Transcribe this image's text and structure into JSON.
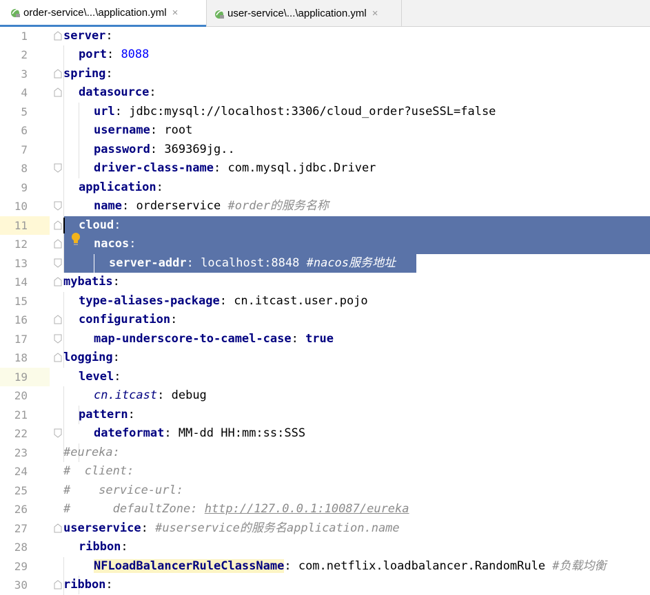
{
  "tabs": [
    {
      "label": "order-service\\...\\application.yml",
      "close": "×",
      "active": true
    },
    {
      "label": "user-service\\...\\application.yml",
      "close": "×",
      "active": false
    }
  ],
  "line_numbers": [
    "1",
    "2",
    "3",
    "4",
    "5",
    "6",
    "7",
    "8",
    "9",
    "10",
    "11",
    "12",
    "13",
    "14",
    "15",
    "16",
    "17",
    "18",
    "19",
    "20",
    "21",
    "22",
    "23",
    "24",
    "25",
    "26",
    "27",
    "28",
    "29",
    "30"
  ],
  "code": {
    "l1_key": "server",
    "l1_punc": ":",
    "l2_key": "port",
    "l2_punc": ": ",
    "l2_val": "8088",
    "l3_key": "spring",
    "l3_punc": ":",
    "l4_key": "datasource",
    "l4_punc": ":",
    "l5_key": "url",
    "l5_punc": ": ",
    "l5_val": "jdbc:mysql://localhost:3306/cloud_order?useSSL=false",
    "l6_key": "username",
    "l6_punc": ": ",
    "l6_val": "root",
    "l7_key": "password",
    "l7_punc": ": ",
    "l7_val": "369369jg..",
    "l8_key": "driver-class-name",
    "l8_punc": ": ",
    "l8_val": "com.mysql.jdbc.Driver",
    "l9_key": "application",
    "l9_punc": ":",
    "l10_key": "name",
    "l10_punc": ": ",
    "l10_val": "orderservice",
    "l10_comment": " #order的服务名称",
    "l11_key": "cloud",
    "l11_punc": ":",
    "l12_key": "nacos",
    "l12_punc": ":",
    "l13_key": "server-addr",
    "l13_punc": ": ",
    "l13_val": "localhost:8848",
    "l13_comment": " #nacos服务地址",
    "l14_key": "mybatis",
    "l14_punc": ":",
    "l15_key": "type-aliases-package",
    "l15_punc": ": ",
    "l15_val": "cn.itcast.user.pojo",
    "l16_key": "configuration",
    "l16_punc": ":",
    "l17_key": "map-underscore-to-camel-case",
    "l17_punc": ": ",
    "l17_val": "true",
    "l18_key": "logging",
    "l18_punc": ":",
    "l19_key": "level",
    "l19_punc": ":",
    "l20_key": "cn.itcast",
    "l20_punc": ": ",
    "l20_val": "debug",
    "l21_key": "pattern",
    "l21_punc": ":",
    "l22_key": "dateformat",
    "l22_punc": ": ",
    "l22_val": "MM-dd HH:mm:ss:SSS",
    "l23_comment": "#eureka:",
    "l24_comment": "#  client:",
    "l25_comment": "#    service-url:",
    "l26_comment_a": "#      defaultZone: ",
    "l26_comment_url": "http://127.0.0.1:10087/eureka",
    "l27_key": "userservice",
    "l27_punc": ": ",
    "l27_comment": "#userservice的服务名application.name",
    "l28_key": "ribbon",
    "l28_punc": ":",
    "l29_key": "NFLoadBalancerRuleClassName",
    "l29_punc": ": ",
    "l29_val": "com.netflix.loadbalancer.RandomRule",
    "l29_comment": " #负载均衡",
    "l30_key": "ribbon",
    "l30_punc": ":"
  },
  "colors": {
    "key": "#000080",
    "number": "#0000ff",
    "comment": "#8c8c8c",
    "selection": "#5a73a8",
    "tab_accent": "#4083c9"
  }
}
